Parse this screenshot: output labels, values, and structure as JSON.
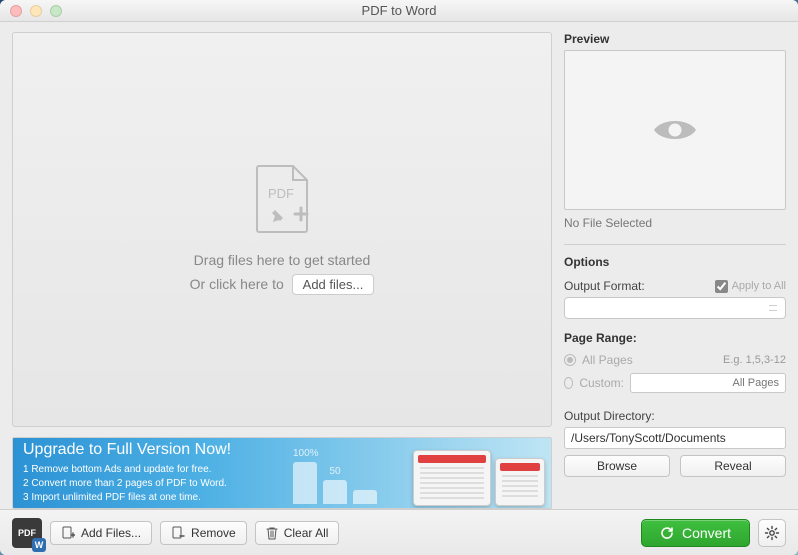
{
  "window": {
    "title": "PDF to Word"
  },
  "dropzone": {
    "icon_label": "PDF",
    "line1": "Drag files here to get started",
    "line2_prefix": "Or click here to",
    "add_button": "Add files..."
  },
  "banner": {
    "headline": "Upgrade to Full Version Now!",
    "items": [
      "1 Remove bottom Ads and update for free.",
      "2 Convert more than 2 pages of PDF to Word.",
      "3 Import unlimited PDF files at one time."
    ],
    "bar_labels": [
      "100%",
      "50"
    ]
  },
  "preview": {
    "title": "Preview",
    "status": "No File Selected"
  },
  "options": {
    "title": "Options",
    "output_format_label": "Output Format:",
    "apply_all": "Apply to All",
    "page_range_label": "Page Range:",
    "all_pages": "All Pages",
    "custom": "Custom:",
    "example": "E.g. 1,5,3-12",
    "custom_placeholder": "All Pages",
    "output_dir_label": "Output Directory:",
    "output_dir_value": "/Users/TonyScott/Documents",
    "browse": "Browse",
    "reveal": "Reveal"
  },
  "toolbar": {
    "logo_text": "PDF",
    "add_files": "Add Files...",
    "remove": "Remove",
    "clear_all": "Clear All",
    "convert": "Convert"
  }
}
